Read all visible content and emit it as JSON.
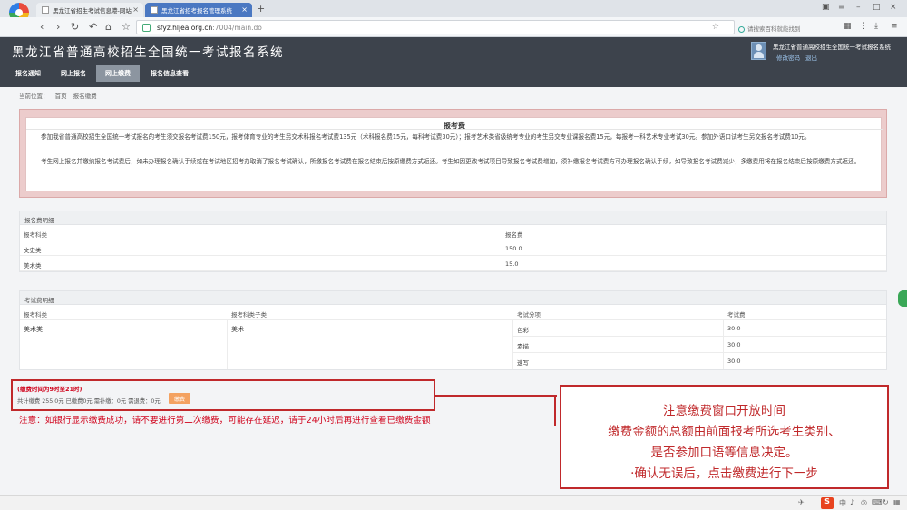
{
  "browser": {
    "tabs": [
      {
        "label": "黑龙江省招生考试信息港-网站"
      },
      {
        "label": "黑龙江省招考报名管理系统"
      }
    ],
    "new_tab": "+",
    "url_prefix": "sfyz.hljea.org.cn",
    "url_suffix": ":7004/main.do",
    "search_hint": "请搜索百科就能找到"
  },
  "app": {
    "title": "黑龙江省普通高校招生全国统一考试报名系统",
    "nav": [
      {
        "label": "报名通知"
      },
      {
        "label": "网上报名"
      },
      {
        "label": "网上缴费"
      },
      {
        "label": "报名信息查看"
      }
    ],
    "user_name": "黑龙江省普通高校招生全国统一考试报名系统",
    "change_password": "修改密码",
    "logout": "退出"
  },
  "breadcrumb": [
    "当前位置：",
    "首页",
    "报名缴费"
  ],
  "fee_notice": {
    "title": "报考费",
    "para1": "参加我省普通高校招生全国统一考试报名的考生须交报名考试费150元，报考体育专业的考生另交术科报名考试费135元（术科报名费15元，每科考试费30元）；报考艺术类省级统考专业的考生另交专业课报名费15元，每报考一科艺术专业考试30元。参加外语口试考生另交报名考试费10元。",
    "para2": "考生网上报名并缴纳报名考试费后，如未办理报名确认手续或在考试地区招考办取消了报名考试确认，所缴报名考试费在报名结束后按原缴费方式返还。考生如因更改考试项目导致报名考试费增加，须补缴报名考试费方可办理报名确认手续，如导致报名考试费减少，多缴费用将在报名结束后按原缴费方式返还。"
  },
  "fee_detail": {
    "header": "报名费明细",
    "columns": [
      "报考科类",
      "报名费"
    ],
    "rows": [
      [
        "文史类",
        "150.0"
      ],
      [
        "美术类",
        "15.0"
      ]
    ]
  },
  "exam_detail": {
    "header": "考试费明细",
    "columns": [
      "报考科类",
      "报考科类子类",
      "考试分项",
      "考试费"
    ],
    "category": "美术类",
    "subcategory": "美术",
    "rows": [
      [
        "色彩",
        "30.0"
      ],
      [
        "素描",
        "30.0"
      ],
      [
        "速写",
        "30.0"
      ]
    ]
  },
  "payment": {
    "time": "(缴费时间为9时至21时)",
    "summary": "共计缴费 255.0元 已缴费0元 需补缴：0元 需退费：0元",
    "button": "缴费",
    "warning": "注意：如银行显示缴费成功，请不要进行第二次缴费，可能存在延迟，请于24小时后再进行查看已缴费金额"
  },
  "callout": {
    "lines": [
      "注意缴费窗口开放时间",
      "缴费金额的总额由前面报考所选考生类别、",
      "是否参加口语等信息决定。",
      "·确认无误后，点击缴费进行下一步"
    ]
  },
  "tray": {
    "ime": "S",
    "icons": [
      "中",
      "♪",
      "◎",
      "⌨",
      "↻",
      "▦"
    ]
  },
  "colors": {
    "header_bg": "#3d434c",
    "active_tab": "#8c95a0",
    "annotation_red": "#c0292b",
    "warning_red": "#d0021b",
    "pay_button": "#f4a261"
  }
}
